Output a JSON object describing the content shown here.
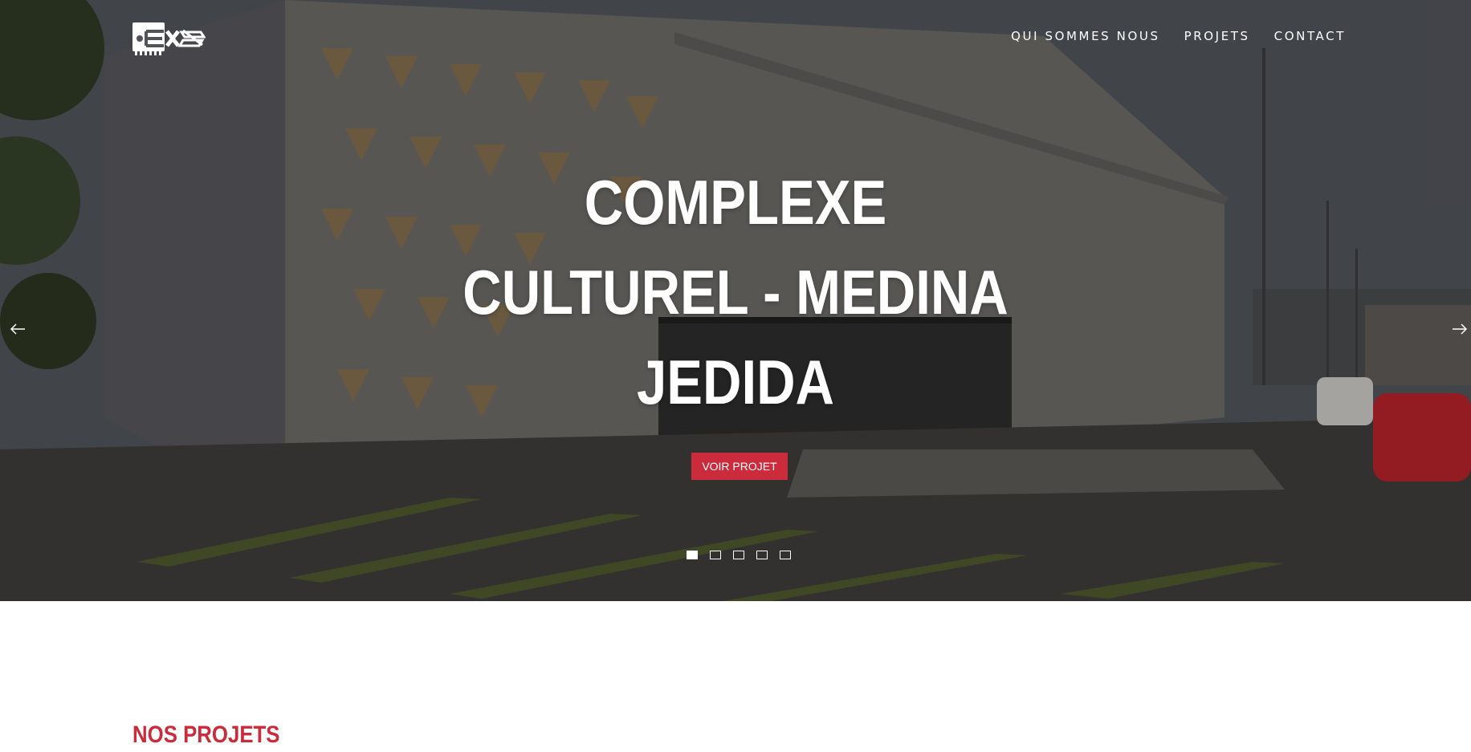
{
  "brand": {
    "logo_icon": "exa-logo-icon"
  },
  "nav": {
    "items": [
      {
        "label": "QUI SOMMES NOUS"
      },
      {
        "label": "PROJETS"
      },
      {
        "label": "CONTACT"
      }
    ]
  },
  "hero": {
    "title_line1": "COMPLEXE",
    "title_line2": "CULTUREL - MEDINA",
    "title_line3": "JEDIDA",
    "cta_label": "VOIR PROJET",
    "prev_icon": "arrow-left-icon",
    "next_icon": "arrow-right-icon",
    "slide_count": 5,
    "active_slide": 1
  },
  "section": {
    "title": "NOS PROJETS"
  },
  "colors": {
    "accent": "#cb2b3b",
    "text_light": "#ffffff",
    "background": "#ffffff"
  }
}
